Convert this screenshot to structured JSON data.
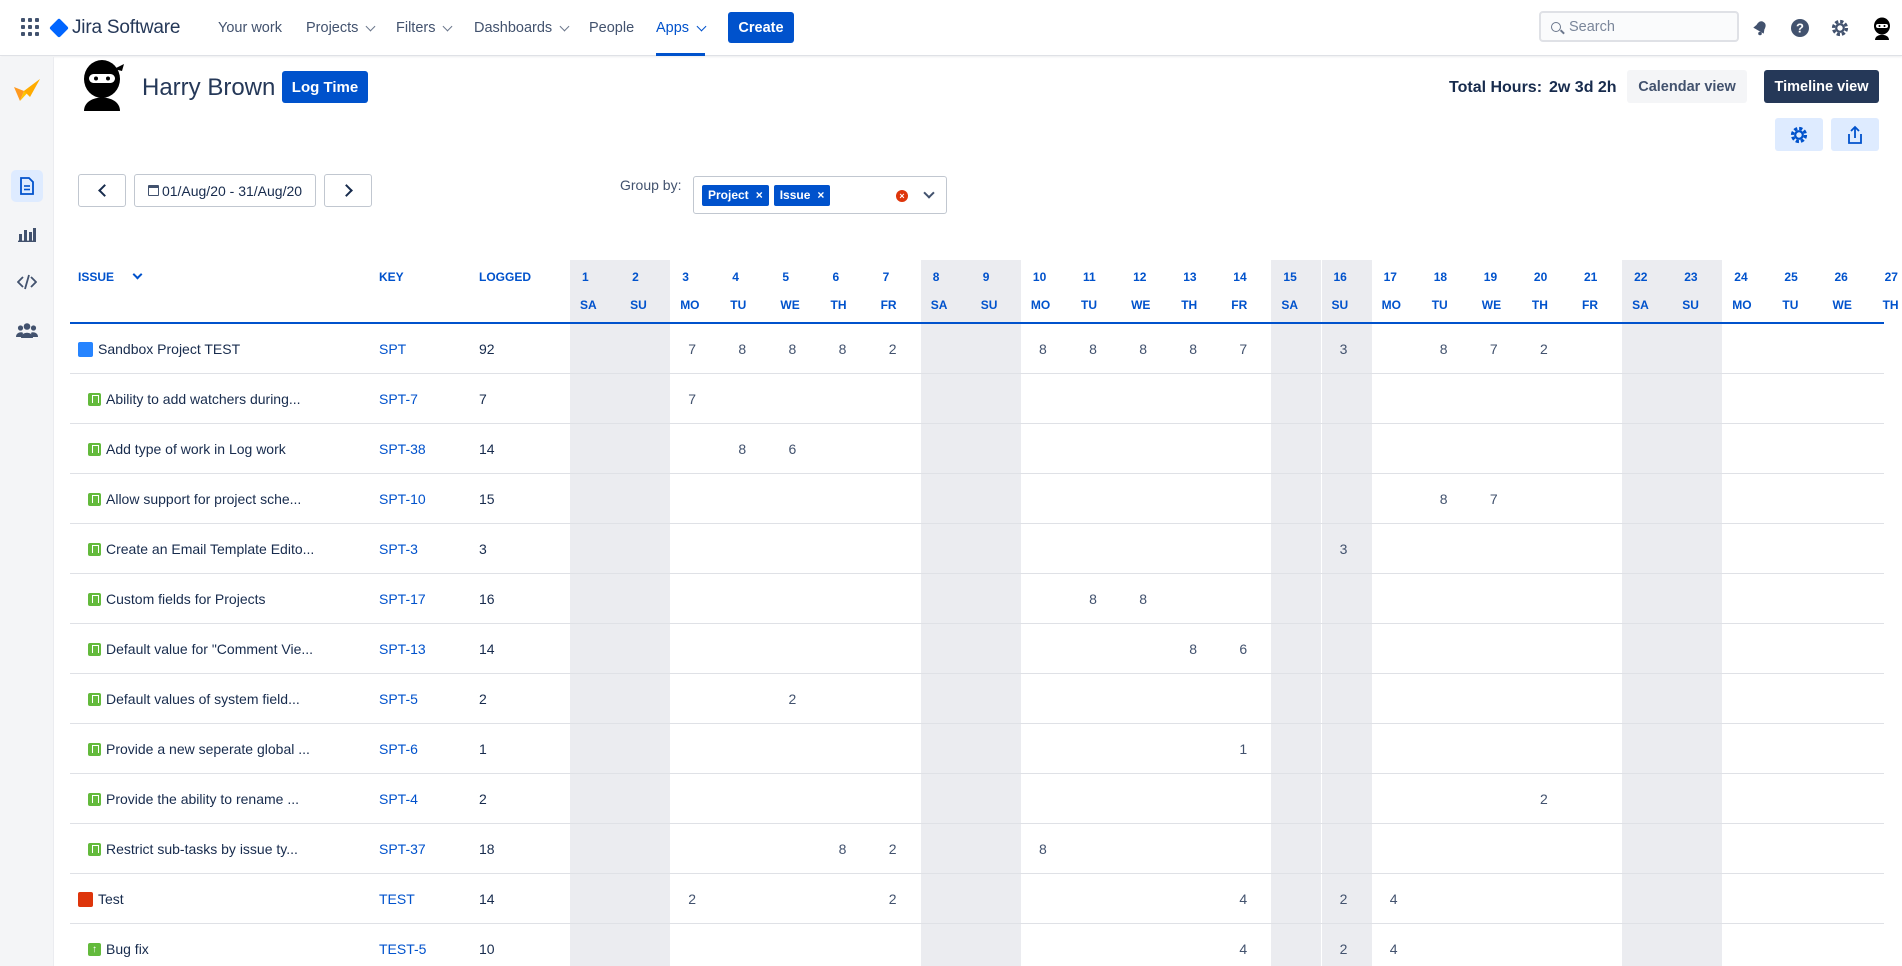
{
  "app": {
    "product": "Jira Software",
    "nav": [
      {
        "label": "Your work",
        "dropdown": false
      },
      {
        "label": "Projects",
        "dropdown": true
      },
      {
        "label": "Filters",
        "dropdown": true
      },
      {
        "label": "Dashboards",
        "dropdown": true
      },
      {
        "label": "People",
        "dropdown": false
      },
      {
        "label": "Apps",
        "dropdown": true,
        "active": true
      }
    ],
    "create_label": "Create",
    "search_placeholder": "Search"
  },
  "header": {
    "user_name": "Harry Brown",
    "log_time_label": "Log Time",
    "total_hours_label": "Total Hours:",
    "total_hours_value": "2w 3d 2h",
    "calendar_view_label": "Calendar view",
    "timeline_view_label": "Timeline view"
  },
  "filters": {
    "date_range": "01/Aug/20 - 31/Aug/20",
    "group_by_label": "Group by:",
    "group_chips": [
      "Project",
      "Issue"
    ]
  },
  "table": {
    "columns": {
      "issue": "ISSUE",
      "key": "KEY",
      "logged": "LOGGED"
    },
    "days": [
      {
        "d": "1",
        "w": "SA",
        "weekend": true
      },
      {
        "d": "2",
        "w": "SU",
        "weekend": true
      },
      {
        "d": "3",
        "w": "MO"
      },
      {
        "d": "4",
        "w": "TU"
      },
      {
        "d": "5",
        "w": "WE"
      },
      {
        "d": "6",
        "w": "TH"
      },
      {
        "d": "7",
        "w": "FR"
      },
      {
        "d": "8",
        "w": "SA",
        "weekend": true
      },
      {
        "d": "9",
        "w": "SU",
        "weekend": true
      },
      {
        "d": "10",
        "w": "MO"
      },
      {
        "d": "11",
        "w": "TU"
      },
      {
        "d": "12",
        "w": "WE"
      },
      {
        "d": "13",
        "w": "TH"
      },
      {
        "d": "14",
        "w": "FR"
      },
      {
        "d": "15",
        "w": "SA",
        "weekend": true
      },
      {
        "d": "16",
        "w": "SU",
        "weekend": true
      },
      {
        "d": "17",
        "w": "MO"
      },
      {
        "d": "18",
        "w": "TU"
      },
      {
        "d": "19",
        "w": "WE"
      },
      {
        "d": "20",
        "w": "TH"
      },
      {
        "d": "21",
        "w": "FR"
      },
      {
        "d": "22",
        "w": "SA",
        "weekend": true
      },
      {
        "d": "23",
        "w": "SU",
        "weekend": true
      },
      {
        "d": "24",
        "w": "MO"
      },
      {
        "d": "25",
        "w": "TU"
      },
      {
        "d": "26",
        "w": "WE"
      },
      {
        "d": "27",
        "w": "TH"
      }
    ],
    "rows": [
      {
        "issue": "Sandbox Project TEST",
        "key": "SPT",
        "logged": "92",
        "type": "project-blue",
        "level": 0,
        "hours": {
          "3": "7",
          "4": "8",
          "5": "8",
          "6": "8",
          "7": "2",
          "10": "8",
          "11": "8",
          "12": "8",
          "13": "8",
          "14": "7",
          "16": "3",
          "18": "8",
          "19": "7",
          "20": "2"
        }
      },
      {
        "issue": "Ability to add watchers during...",
        "key": "SPT-7",
        "logged": "7",
        "type": "story",
        "level": 1,
        "hours": {
          "3": "7"
        }
      },
      {
        "issue": "Add type of work in Log work",
        "key": "SPT-38",
        "logged": "14",
        "type": "story",
        "level": 1,
        "hours": {
          "4": "8",
          "5": "6"
        }
      },
      {
        "issue": "Allow support for project sche...",
        "key": "SPT-10",
        "logged": "15",
        "type": "story",
        "level": 1,
        "hours": {
          "18": "8",
          "19": "7"
        }
      },
      {
        "issue": "Create an Email Template Edito...",
        "key": "SPT-3",
        "logged": "3",
        "type": "story",
        "level": 1,
        "hours": {
          "16": "3"
        }
      },
      {
        "issue": "Custom fields for Projects",
        "key": "SPT-17",
        "logged": "16",
        "type": "story",
        "level": 1,
        "hours": {
          "11": "8",
          "12": "8"
        }
      },
      {
        "issue": "Default value for \"Comment Vie...",
        "key": "SPT-13",
        "logged": "14",
        "type": "story",
        "level": 1,
        "hours": {
          "13": "8",
          "14": "6"
        }
      },
      {
        "issue": "Default values of system field...",
        "key": "SPT-5",
        "logged": "2",
        "type": "story",
        "level": 1,
        "hours": {
          "5": "2"
        }
      },
      {
        "issue": "Provide a new seperate global ...",
        "key": "SPT-6",
        "logged": "1",
        "type": "story",
        "level": 1,
        "hours": {
          "14": "1"
        }
      },
      {
        "issue": "Provide the ability to rename ...",
        "key": "SPT-4",
        "logged": "2",
        "type": "story",
        "level": 1,
        "hours": {
          "20": "2"
        }
      },
      {
        "issue": "Restrict sub-tasks by issue ty...",
        "key": "SPT-37",
        "logged": "18",
        "type": "story",
        "level": 1,
        "hours": {
          "6": "8",
          "7": "2",
          "10": "8"
        }
      },
      {
        "issue": "Test",
        "key": "TEST",
        "logged": "14",
        "type": "project-red",
        "level": 0,
        "hours": {
          "3": "2",
          "7": "2",
          "14": "4",
          "16": "2",
          "17": "4"
        }
      },
      {
        "issue": "Bug fix",
        "key": "TEST-5",
        "logged": "10",
        "type": "improvement",
        "level": 1,
        "hours": {
          "14": "4",
          "16": "2",
          "17": "4"
        }
      }
    ]
  },
  "colors": {
    "accent": "#0052cc",
    "weekend": "#ebecf0",
    "story": "#63ba3c",
    "dark_button": "#253858"
  }
}
